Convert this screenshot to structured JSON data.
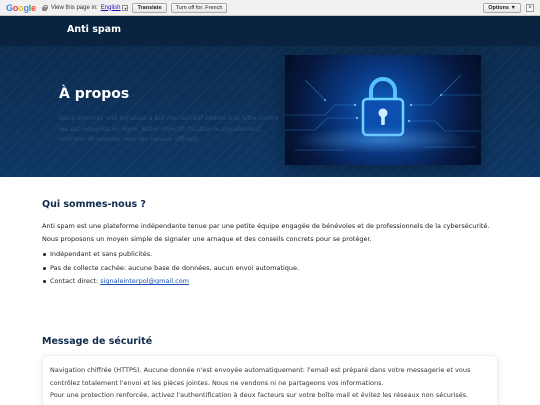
{
  "translate_bar": {
    "view_label": "View this page in:",
    "language": "English",
    "translate_label": "Translate",
    "turn_off_label": "Turn off for: French",
    "options_label": "Options ▼",
    "close_label": "×"
  },
  "header": {
    "brand": "Anti spam"
  },
  "hero": {
    "title": "À propos",
    "description": "Nous sommes une initiative à but non lucratif dédiée à la lutte contre les escroqueries en ligne. Notre objectif: faciliter le signalement, informer et orienter vers les canaux officiels.",
    "image_icon": "padlock-icon"
  },
  "about": {
    "title": "Qui sommes-nous ?",
    "text": "Anti spam est une plateforme indépendante tenue par une petite équipe engagée de bénévoles et de professionnels de la cybersécurité. Nous proposons un moyen simple de signaler une arnaque et des conseils concrets pour se protéger.",
    "bullets": [
      "Indépendant et sans publicités.",
      "Pas de collecte cachée: aucune base de données, aucun envoi automatique."
    ],
    "contact_label": "Contact direct:",
    "contact_email": "signaleinterpol@gmail.com"
  },
  "security": {
    "title": "Message de sécurité",
    "text1": "Navigation chiffrée (HTTPS). Aucune donnée n'est envoyée automatiquement: l'email est préparé dans votre messagerie et vous contrôlez totalement l'envoi et les pièces jointes. Nous ne vendons ni ne partageons vos informations.",
    "text2": "Pour une protection renforcée, activez l'authentification à deux facteurs sur votre boîte mail et évitez les réseaux non sécurisés."
  }
}
